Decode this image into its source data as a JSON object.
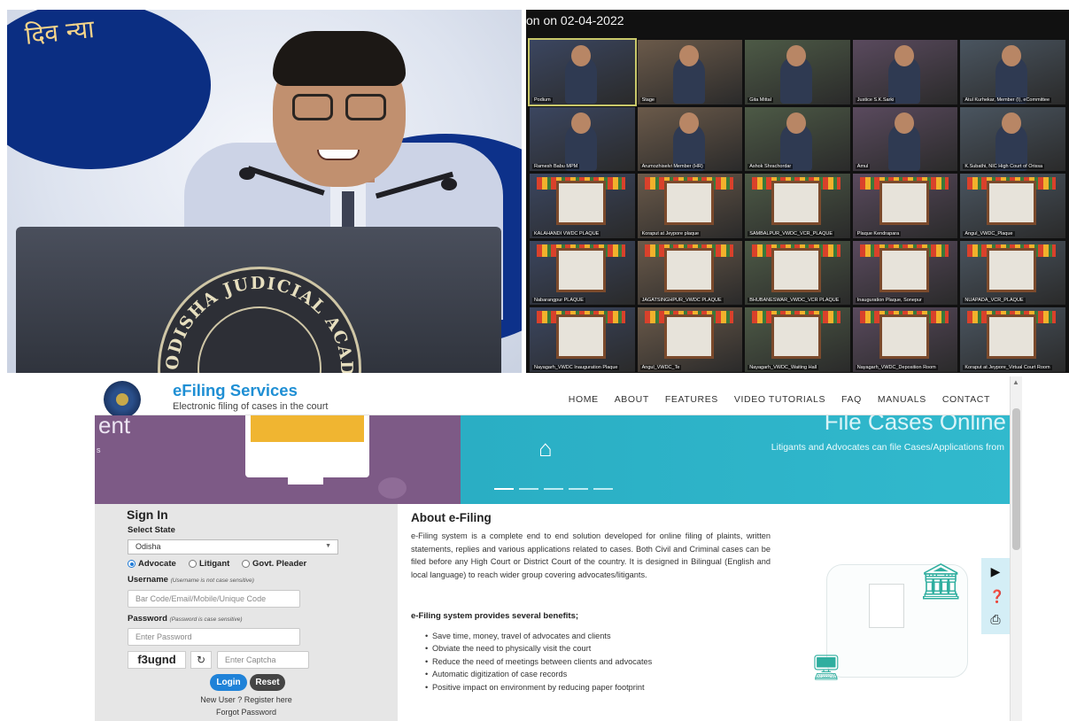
{
  "speaker_photo": {
    "top_text": "दिव न्या",
    "seal_text": "ODISHA JUDICIAL ACADEMY"
  },
  "video_grid": {
    "header": "on on 02-04-2022",
    "tiles": [
      "Podium",
      "Stage",
      "Gita Mittal",
      "Justice S.K.Sarki",
      "Atul Kurhekar, Member (I), eCommittee",
      "Ramesh Babu MPM",
      "Arumozhiselvi Member (HR)",
      "Ashok Shrachordar",
      "Amul",
      "K.Subathi, NIC High Court of Orissa",
      "KALAHANDI VWDC PLAQUE",
      "Koraput at Jeypore plaque",
      "SAMBALPUR_VWDC_VCR_PLAQUE",
      "Plaque Kendrapara",
      "Angul_VWDC_Plaque",
      "Nabarangpur PLAQUE",
      "JAGATSINGHPUR_VWDC PLAQUE",
      "BHUBANESWAR_VWDC_VCR PLAQUE",
      "Inauguration Plaque, Sonepur",
      "NUAPADA_VCR_PLAQUE",
      "Nayagarh_VWDC Inauguration Plaque",
      "Angul_VWDC_Te",
      "Nayagarh_VWDC_Waiting Hall",
      "Nayagarh_VWDC_Deposition Room",
      "Koraput at Jeypore_Virtual Court Room"
    ]
  },
  "efiling": {
    "site_title": "eFiling Services",
    "site_subtitle": "Electronic filing of cases in the court",
    "nav": [
      "HOME",
      "ABOUT",
      "FEATURES",
      "VIDEO TUTORIALS",
      "FAQ",
      "MANUALS",
      "CONTACT"
    ],
    "banner": {
      "left_fragment": "ent",
      "left_small": "s",
      "title": "File Cases Online",
      "caption": "Litigants and Advocates can file Cases/Applications from"
    },
    "signin": {
      "title": "Sign In",
      "select_state_label": "Select State",
      "state_value": "Odisha",
      "radio_options": [
        "Advocate",
        "Litigant",
        "Govt. Pleader"
      ],
      "selected_radio": "Advocate",
      "username_label": "Username",
      "username_hint": "(Username is not case sensitive)",
      "username_placeholder": "Bar Code/Email/Mobile/Unique Code",
      "password_label": "Password",
      "password_hint": "(Password is case sensitive)",
      "password_placeholder": "Enter Password",
      "captcha_code": "f3ugnd",
      "captcha_placeholder": "Enter Captcha",
      "login_label": "Login",
      "reset_label": "Reset",
      "new_user": "New User ? Register here",
      "forgot": "Forgot Password"
    },
    "about": {
      "title": "About e-Filing",
      "text": "e-Filing system is a complete end to end solution developed for online filing of plaints, written statements, replies and various applications related to cases. Both Civil and Criminal cases can be filed before any High Court or District Court of the country. It is designed in Bilingual (English and local language) to reach wider group covering advocates/litigants.",
      "benefits_title": "e-Filing system provides several benefits;",
      "benefits": [
        "Save time, money, travel of advocates and clients",
        "Obviate the need to physically visit the court",
        "Reduce the need of meetings between clients and advocates",
        "Automatic digitization of case records",
        "Positive impact on environment by reducing paper footprint"
      ]
    },
    "side_tools": [
      "play-icon",
      "help-icon",
      "pdf-icon"
    ],
    "colors": {
      "brand_blue": "#1f8fd4",
      "banner_teal": "#31b9cd",
      "banner_purple": "#7d5a86",
      "accent_green": "#2fae9f"
    }
  }
}
